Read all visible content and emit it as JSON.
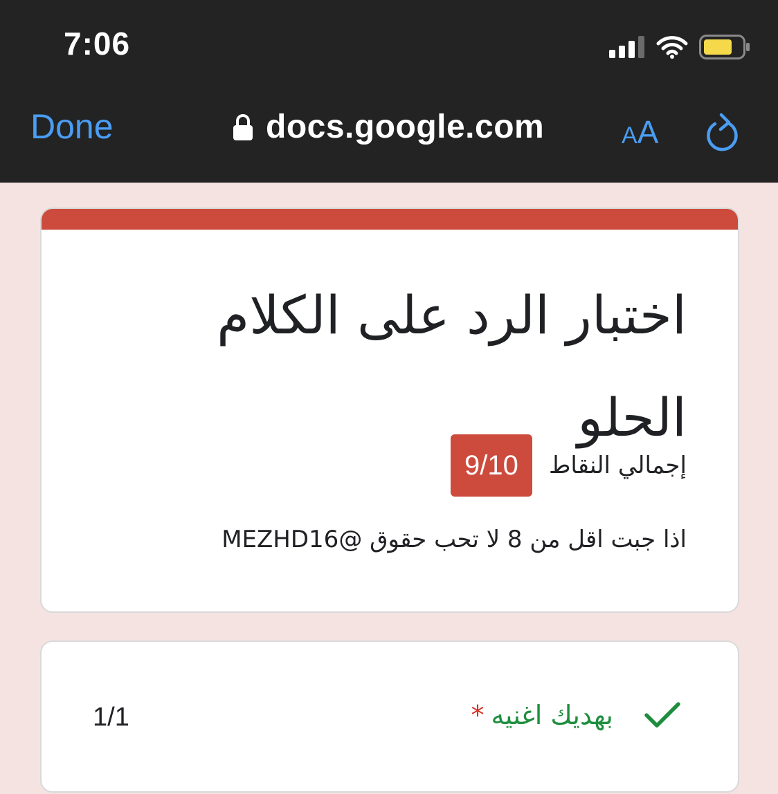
{
  "status_bar": {
    "time": "7:06",
    "icons": [
      "signal-icon",
      "wifi-icon",
      "battery-icon"
    ],
    "battery_color": "#f5d94a"
  },
  "browser": {
    "done_label": "Done",
    "url": "docs.google.com",
    "text_size_small": "A",
    "text_size_large": "A",
    "icons": [
      "lock-icon",
      "reload-icon"
    ],
    "accent_color": "#4a9df2"
  },
  "form": {
    "title": "اختبار الرد على الكلام الحلو",
    "score_label": "إجمالي النقاط",
    "score": "9/10",
    "description": "اذا جبت اقل من 8 لا تحب حقوق @MEZHD16",
    "accent_color": "#cc4b3d"
  },
  "questions": [
    {
      "text": "بهديك اغنيه",
      "required_mark": "*",
      "score": "1/1",
      "status_icon": "check-icon",
      "status_color": "#1e8e3e"
    }
  ]
}
